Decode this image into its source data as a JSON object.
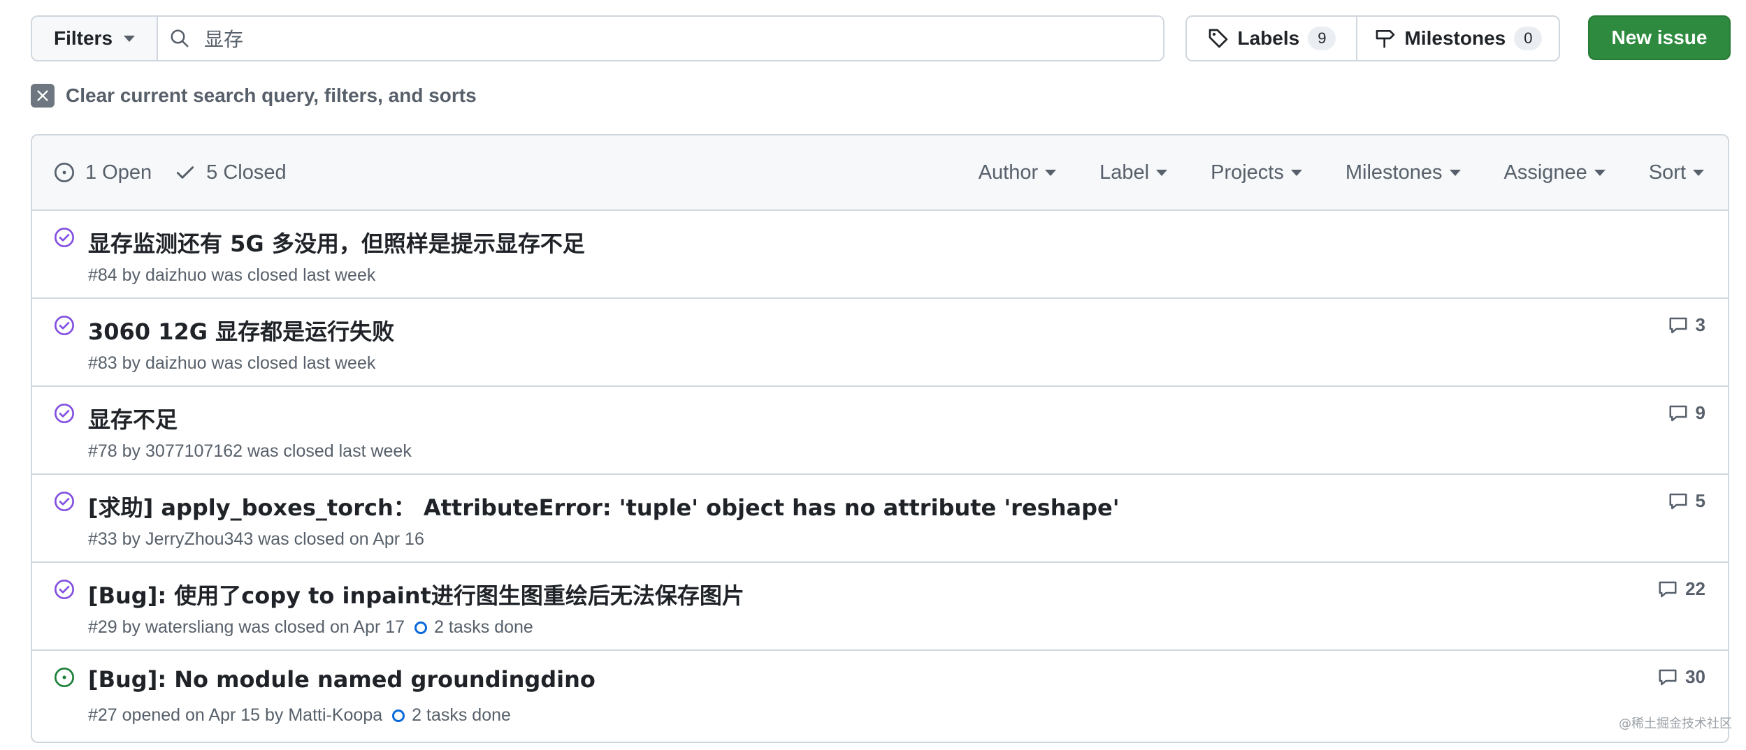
{
  "toolbar": {
    "filters_label": "Filters",
    "search_value": "显存",
    "labels_label": "Labels",
    "labels_count": "9",
    "milestones_label": "Milestones",
    "milestones_count": "0",
    "new_issue_label": "New issue"
  },
  "clear_filters": "Clear current search query, filters, and sorts",
  "tabs": {
    "open": "1 Open",
    "closed": "5 Closed"
  },
  "sort_options": [
    "Author",
    "Label",
    "Projects",
    "Milestones",
    "Assignee",
    "Sort"
  ],
  "issues": [
    {
      "state": "closed",
      "title": "显存监测还有 5G 多没用，但照样是提示显存不足",
      "meta": "#84 by daizhuo was closed last week",
      "tasks": "",
      "comments": ""
    },
    {
      "state": "closed",
      "title": "3060 12G 显存都是运行失败",
      "meta": "#83 by daizhuo was closed last week",
      "tasks": "",
      "comments": "3"
    },
    {
      "state": "closed",
      "title": "显存不足",
      "meta": "#78 by 3077107162 was closed last week",
      "tasks": "",
      "comments": "9"
    },
    {
      "state": "closed",
      "title": "[求助] apply_boxes_torch：  AttributeError: 'tuple' object has no attribute 'reshape'",
      "meta": "#33 by JerryZhou343 was closed on Apr 16",
      "tasks": "",
      "comments": "5"
    },
    {
      "state": "closed",
      "title": "[Bug]: 使用了copy to inpaint进行图生图重绘后无法保存图片",
      "meta": "#29 by watersliang was closed on Apr 17",
      "tasks": "2 tasks done",
      "comments": "22"
    },
    {
      "state": "open",
      "title": "[Bug]: No module named groundingdino",
      "meta": "#27 opened on Apr 15 by Matti-Koopa",
      "tasks": "2 tasks done",
      "comments": "30"
    }
  ],
  "watermark": "@稀土掘金技术社区",
  "colors": {
    "closed_icon": "#8250df",
    "open_icon": "#1a7f37",
    "primary_button": "#2d8a3e"
  }
}
